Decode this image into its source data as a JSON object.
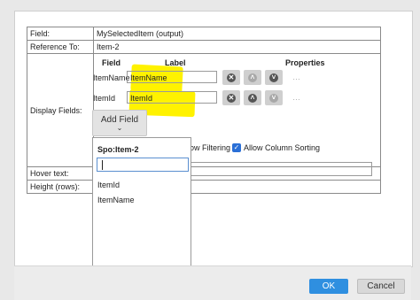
{
  "dialog": {
    "field_label": "Field:",
    "field_value": "MySelectedItem (output)",
    "reference_label": "Reference To:",
    "reference_value": "Item-2",
    "display_fields_label": "Display Fields:",
    "hover_text_label": "Hover text:",
    "height_label": "Height (rows):",
    "columns": {
      "field": "Field",
      "label": "Label",
      "properties": "Properties"
    },
    "rows": [
      {
        "field": "ItemName",
        "label": "ItemName"
      },
      {
        "field": "ItemId",
        "label": "ItemId"
      }
    ],
    "add_field": "Add Field",
    "show_filtering_text": "ow Filtering",
    "allow_sorting_text": "Allow Column Sorting",
    "more_glyph": "…"
  },
  "dropdown": {
    "header": "Spo:Item-2",
    "search_value": "",
    "options": [
      "ItemId",
      "ItemName"
    ]
  },
  "footer": {
    "ok": "OK",
    "cancel": "Cancel"
  },
  "colors": {
    "highlight": "#fff200",
    "primary": "#2f8fe0"
  }
}
